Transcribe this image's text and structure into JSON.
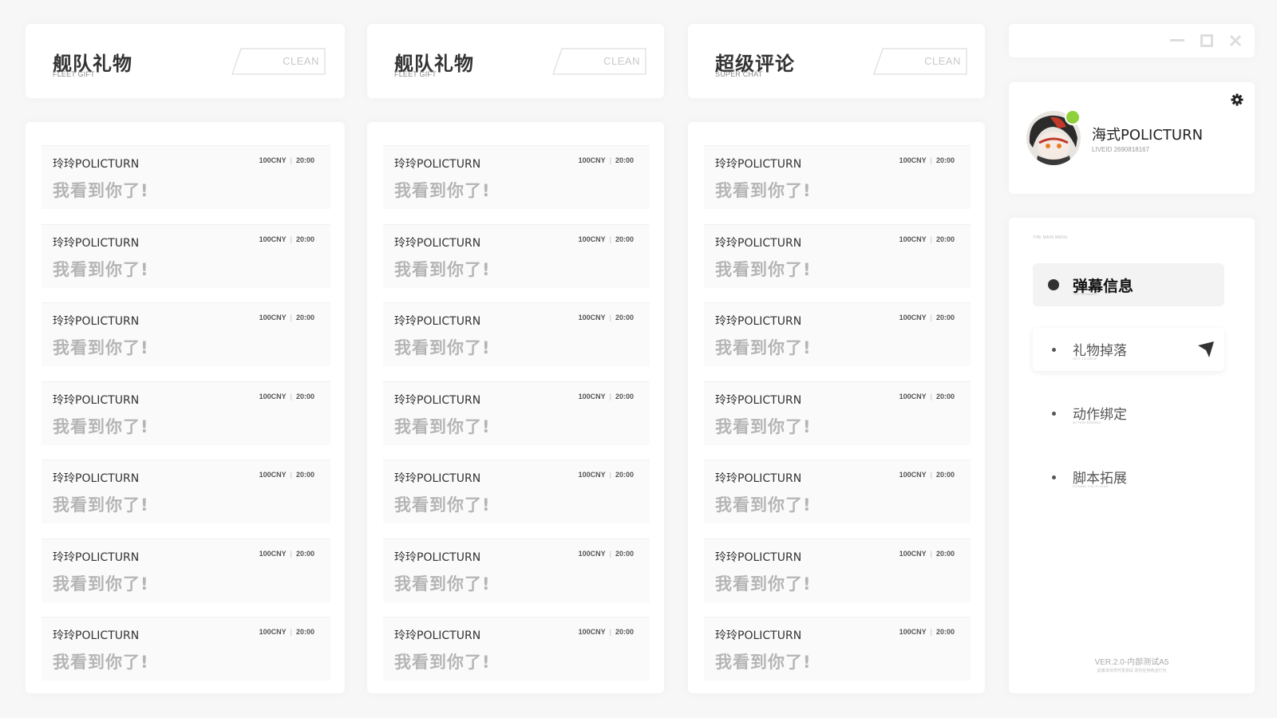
{
  "columns": [
    {
      "title": "舰队礼物",
      "subtitle": "FLEET GIFT",
      "clean_label": "CLEAN"
    },
    {
      "title": "舰队礼物",
      "subtitle": "FLEET GIFT",
      "clean_label": "CLEAN"
    },
    {
      "title": "超级评论",
      "subtitle": "SUPER CHAT",
      "clean_label": "CLEAN"
    }
  ],
  "message": {
    "user": "玲玲POLICTURN",
    "amount": "100CNY",
    "time": "20:00",
    "text": "我看到你了!"
  },
  "messages_per_column": 7,
  "window_controls": [
    "minimize-icon",
    "maximize-icon",
    "close-icon"
  ],
  "profile": {
    "name": "海式POLICTURN",
    "live_id": "LIVEID 2690818167",
    "status_color": "#8fd13a"
  },
  "menu": {
    "label": "THE MAIN MENU",
    "items": [
      {
        "label": "弹幕信息",
        "sub": "THE DANMAKU",
        "state": "active"
      },
      {
        "label": "礼物掉落",
        "sub": "GIFT TO DROP",
        "state": "hover"
      },
      {
        "label": "动作绑定",
        "sub": "ACTION BINDING",
        "state": "normal"
      },
      {
        "label": "脚本拓展",
        "sub": "EXPAND THE PLUGIN",
        "state": "normal"
      }
    ]
  },
  "footer": {
    "version": "VER.2.0-内部测试A5",
    "notice": "此版本仅供开发测试 请勿任何商业行为"
  }
}
